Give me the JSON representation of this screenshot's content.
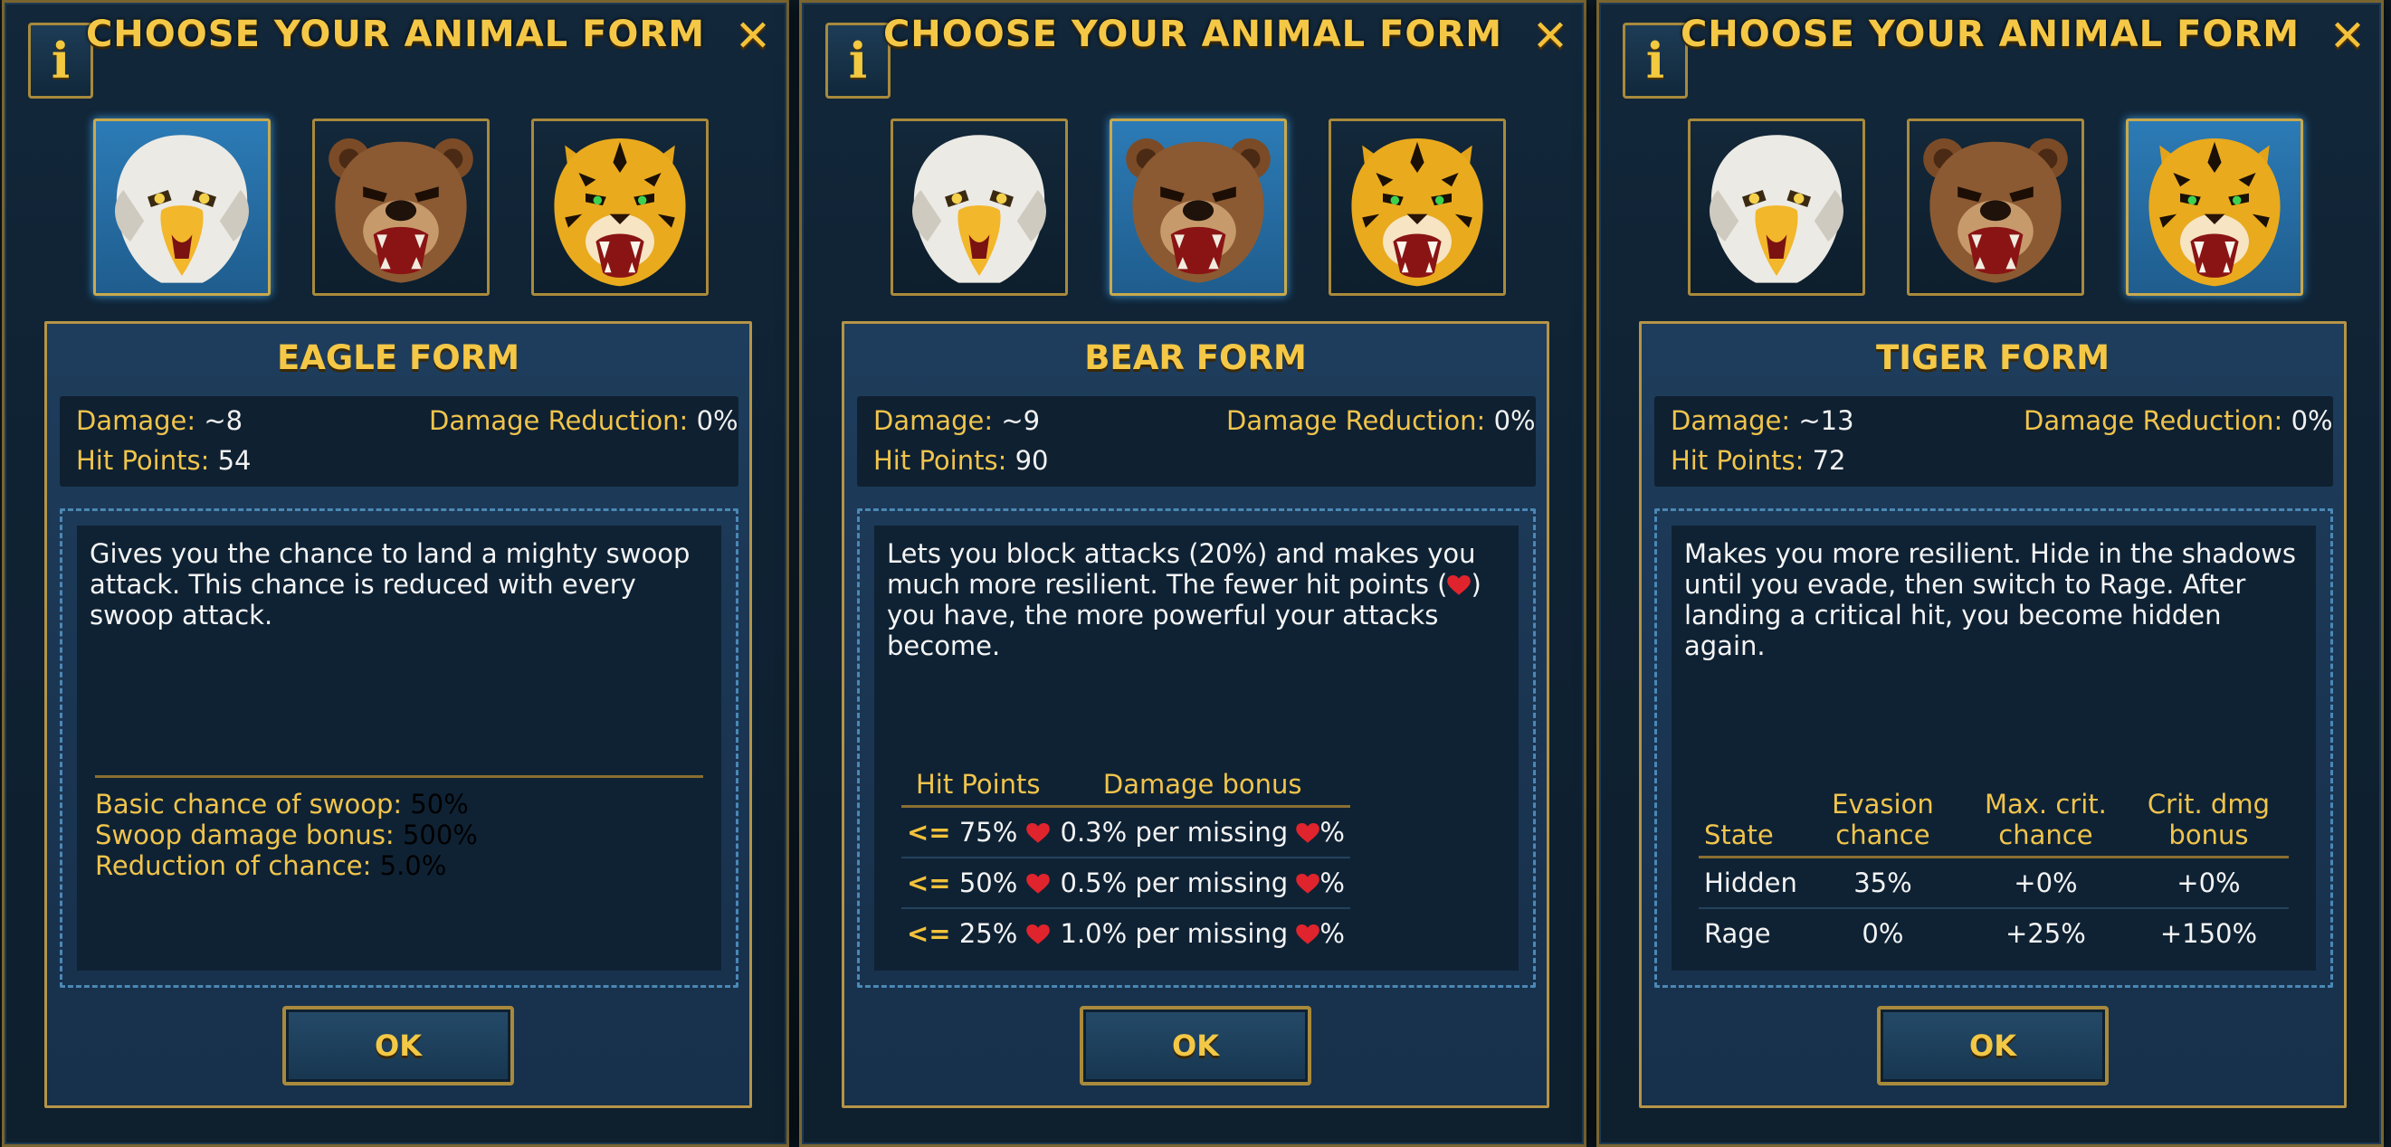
{
  "panels": [
    {
      "title": "CHOOSE YOUR ANIMAL FORM",
      "info_label": "i",
      "close_label": "✕",
      "selected": "eagle",
      "form_title": "EAGLE FORM",
      "damage_label": "Damage:",
      "damage_value": "~8",
      "hp_label": "Hit Points:",
      "hp_value": "54",
      "reduction_label": "Damage Reduction:",
      "reduction_value": "0%",
      "description": "Gives you the chance to land a mighty swoop attack. This chance is reduced with every swoop attack.",
      "swoop": [
        {
          "label": "Basic chance of swoop:",
          "value": "50%"
        },
        {
          "label": "Swoop damage bonus:",
          "value": "500%"
        },
        {
          "label": "Reduction of chance:",
          "value": "5.0%"
        }
      ],
      "ok_label": "OK"
    },
    {
      "title": "CHOOSE YOUR ANIMAL FORM",
      "info_label": "i",
      "close_label": "✕",
      "selected": "bear",
      "form_title": "BEAR FORM",
      "damage_label": "Damage:",
      "damage_value": "~9",
      "hp_label": "Hit Points:",
      "hp_value": "90",
      "reduction_label": "Damage Reduction:",
      "reduction_value": "0%",
      "description_a": "Lets you block attacks (20%) and makes you much more resilient. The fewer hit points (",
      "description_b": ") you have, the more powerful your attacks become.",
      "table_headers": [
        "Hit Points",
        "Damage bonus"
      ],
      "rows": [
        {
          "arrow": "<=",
          "threshold": "75%",
          "bonus_a": "0.3% per missing",
          "bonus_b": "%"
        },
        {
          "arrow": "<=",
          "threshold": "50%",
          "bonus_a": "0.5% per missing",
          "bonus_b": "%"
        },
        {
          "arrow": "<=",
          "threshold": "25%",
          "bonus_a": "1.0% per missing",
          "bonus_b": "%"
        }
      ],
      "ok_label": "OK"
    },
    {
      "title": "CHOOSE YOUR ANIMAL FORM",
      "info_label": "i",
      "close_label": "✕",
      "selected": "tiger",
      "form_title": "TIGER FORM",
      "damage_label": "Damage:",
      "damage_value": "~13",
      "hp_label": "Hit Points:",
      "hp_value": "72",
      "reduction_label": "Damage Reduction:",
      "reduction_value": "0%",
      "description": "Makes you more resilient. Hide in the shadows until you evade, then switch to Rage. After landing a critical hit, you become hidden again.",
      "table_headers": [
        "State",
        "Evasion chance",
        "Max. crit. chance",
        "Crit. dmg bonus"
      ],
      "rows": [
        {
          "state": "Hidden",
          "evasion": "35%",
          "crit": "+0%",
          "dmg": "+0%"
        },
        {
          "state": "Rage",
          "evasion": "0%",
          "crit": "+25%",
          "dmg": "+150%"
        }
      ],
      "ok_label": "OK"
    }
  ],
  "icons": {
    "eagle": "eagle-icon",
    "bear": "bear-icon",
    "tiger": "tiger-icon",
    "heart": "heart-icon"
  },
  "colors": {
    "gold": "#f4c846",
    "selected_portrait": "#2c7bb6",
    "heart": "#e0242d"
  }
}
